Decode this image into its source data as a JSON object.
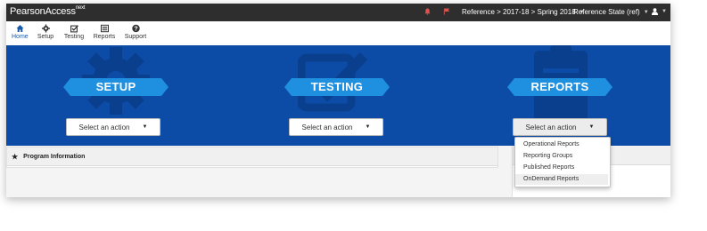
{
  "app": {
    "brand": "PearsonAccess",
    "brand_sup": "next"
  },
  "topbar": {
    "breadcrumb": "Reference > 2017-18 > Spring 2018",
    "org": "Reference State (ref)",
    "icons": [
      "bell-icon",
      "flag-icon",
      "user-icon"
    ],
    "alert_color": "#d9534f"
  },
  "nav": {
    "items": [
      {
        "label": "Home",
        "icon": "home-icon",
        "active": true
      },
      {
        "label": "Setup",
        "icon": "gear-icon"
      },
      {
        "label": "Testing",
        "icon": "checkbox-icon"
      },
      {
        "label": "Reports",
        "icon": "list-icon"
      },
      {
        "label": "Support",
        "icon": "question-icon"
      }
    ]
  },
  "banner": {
    "color": "#0d4ca6",
    "ribbon_color": "#1f8fe0",
    "sections": [
      {
        "title": "SETUP",
        "select_label": "Select an action"
      },
      {
        "title": "TESTING",
        "select_label": "Select an action"
      },
      {
        "title": "REPORTS",
        "select_label": "Select an action"
      }
    ]
  },
  "reports_menu": {
    "items": [
      "Operational Reports",
      "Reporting Groups",
      "Published Reports",
      "OnDemand Reports"
    ],
    "highlighted": "OnDemand Reports"
  },
  "program_info": {
    "title": "Program Information",
    "icon": "star-icon"
  }
}
